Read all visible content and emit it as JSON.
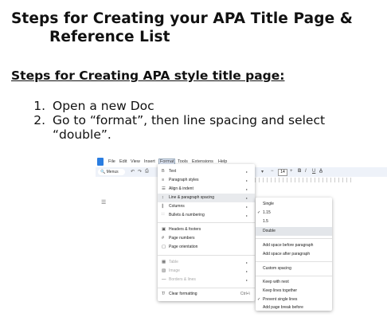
{
  "title": {
    "line1": "Steps for Creating your APA Title Page &",
    "line2": "Reference List"
  },
  "subtitle": "Steps for Creating APA style title page:",
  "steps": [
    "Open a new Doc",
    "Go to “format”, then line spacing and select “double”."
  ],
  "screenshot": {
    "menubar": [
      "File",
      "Edit",
      "View",
      "Insert",
      "Format",
      "Tools",
      "Extensions",
      "Help"
    ],
    "active_menu": "Format",
    "toolbar": {
      "menus_label": "Menus",
      "font_size": "14",
      "bold": "B",
      "italic": "I",
      "underline": "U"
    },
    "format_menu": [
      {
        "icon": "B",
        "label": "Text",
        "arrow": "▸"
      },
      {
        "icon": "≡",
        "label": "Paragraph styles",
        "arrow": "▸"
      },
      {
        "icon": "☰",
        "label": "Align & indent",
        "arrow": "▸"
      },
      {
        "icon": "↕",
        "label": "Line & paragraph spacing",
        "arrow": "▸"
      },
      {
        "icon": "∥",
        "label": "Columns",
        "arrow": "▸"
      },
      {
        "icon": "∷",
        "label": "Bullets & numbering",
        "arrow": "▸"
      },
      {
        "icon": "▣",
        "label": "Headers & footers",
        "arrow": ""
      },
      {
        "icon": "#",
        "label": "Page numbers",
        "arrow": ""
      },
      {
        "icon": "▢",
        "label": "Page orientation",
        "arrow": ""
      },
      {
        "icon": "▦",
        "label": "Table",
        "arrow": "▸"
      },
      {
        "icon": "▧",
        "label": "Image",
        "arrow": "▸"
      },
      {
        "icon": "—",
        "label": "Borders & lines",
        "arrow": "▸"
      },
      {
        "icon": "T̸",
        "label": "Clear formatting",
        "shortcut": "Ctrl+\\"
      }
    ],
    "spacing_submenu": [
      {
        "check": "",
        "label": "Single"
      },
      {
        "check": "✓",
        "label": "1.15"
      },
      {
        "check": "",
        "label": "1.5"
      },
      {
        "check": "",
        "label": "Double"
      },
      {
        "check": "",
        "label": "Add space before paragraph"
      },
      {
        "check": "",
        "label": "Add space after paragraph"
      },
      {
        "check": "",
        "label": "Custom spacing"
      },
      {
        "check": "",
        "label": "Keep with next"
      },
      {
        "check": "",
        "label": "Keep lines together"
      },
      {
        "check": "✓",
        "label": "Prevent single lines"
      },
      {
        "check": "",
        "label": "Add page break before"
      }
    ]
  }
}
